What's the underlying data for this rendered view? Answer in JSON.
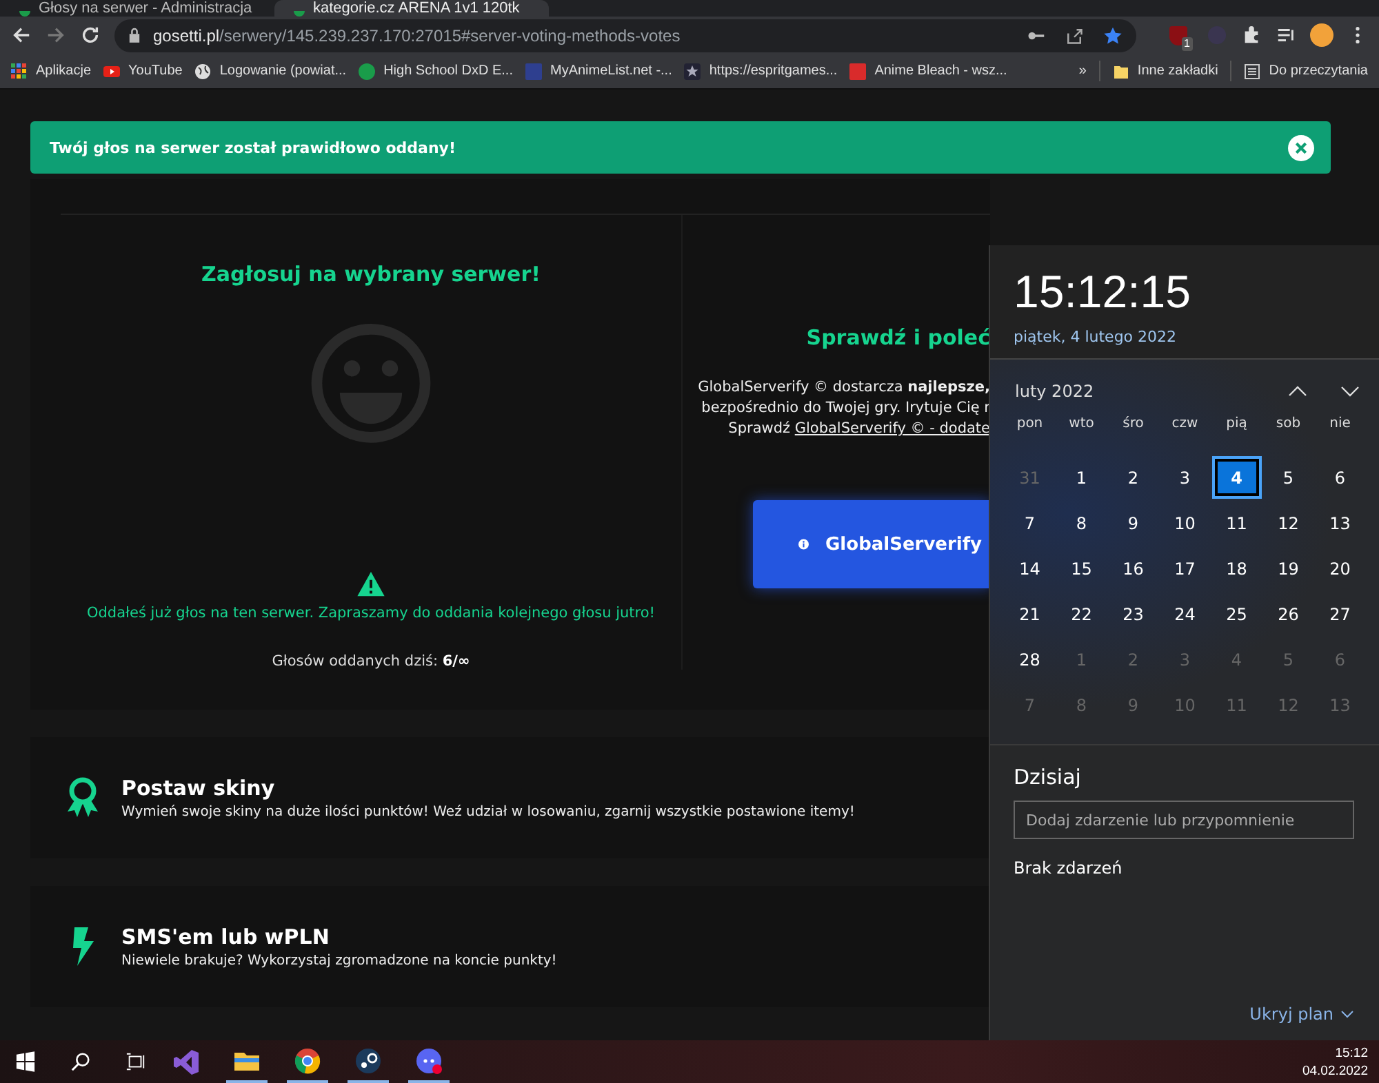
{
  "browser": {
    "tabs": [
      {
        "title": "Głosy na serwer - Administracja",
        "selected": false
      },
      {
        "title": "kategorie.cz ARENA 1v1 120tk",
        "selected": true
      }
    ],
    "url": {
      "host": "gosetti.pl",
      "path": "/serwery/145.239.237.170:27015#server-voting-methods-votes"
    },
    "extension_badge": "1",
    "bookmarks": [
      {
        "kind": "apps",
        "label": "Aplikacje"
      },
      {
        "kind": "youtube",
        "label": "YouTube"
      },
      {
        "kind": "globe",
        "label": "Logowanie (powiat..."
      },
      {
        "kind": "green",
        "label": "High School DxD E..."
      },
      {
        "kind": "navy",
        "label": "MyAnimeList.net -..."
      },
      {
        "kind": "star",
        "label": "https://espritgames..."
      },
      {
        "kind": "red",
        "label": "Anime Bleach - wsz..."
      }
    ],
    "overflow": "»",
    "other_bookmarks": "Inne zakładki",
    "reading_list": "Do przeczytania"
  },
  "alert": {
    "message": "Twój głos na serwer został prawidłowo oddany!",
    "dismissible": true
  },
  "vote": {
    "title": "Zagłosuj na wybrany serwer!",
    "notice": "Oddałeś już głos na ten serwer. Zapraszamy do oddania kolejnego głosu jutro!",
    "count_label": "Głosów oddanych dziś:",
    "count_value": "6/∞"
  },
  "promo": {
    "title": "Sprawdź i poleć",
    "lines": [
      "GlobalServerify © dostarcza **najlepsze,**",
      "bezpośrednio do Twojej gry. Irytuje Cię r"
    ],
    "link_prefix": "Sprawdź",
    "link": "GlobalServerify © - dodate",
    "button": "GlobalServerify"
  },
  "features": [
    {
      "kind": "award",
      "title": "Postaw skiny",
      "text": "Wymień swoje skiny na duże ilości punktów! Weź udział w losowaniu, zgarnij wszystkie postawione itemy!"
    },
    {
      "kind": "bolt",
      "title": "SMS'em lub wPLN",
      "text": "Niewiele brakuje? Wykorzystaj zgromadzone na koncie punkty!"
    }
  ],
  "calendar": {
    "time": "15:12:15",
    "date": "piątek, 4 lutego 2022",
    "month": "luty 2022",
    "weekdays": [
      "pon",
      "wto",
      "śro",
      "czw",
      "pią",
      "sob",
      "nie"
    ],
    "weeks": [
      [
        {
          "day": "31",
          "current": false,
          "selected": false
        },
        {
          "day": "1",
          "current": true,
          "selected": false
        },
        {
          "day": "2",
          "current": true,
          "selected": false
        },
        {
          "day": "3",
          "current": true,
          "selected": false
        },
        {
          "day": "4",
          "current": true,
          "selected": true
        },
        {
          "day": "5",
          "current": true,
          "selected": false
        },
        {
          "day": "6",
          "current": true,
          "selected": false
        }
      ],
      [
        {
          "day": "7",
          "current": true,
          "selected": false
        },
        {
          "day": "8",
          "current": true,
          "selected": false
        },
        {
          "day": "9",
          "current": true,
          "selected": false
        },
        {
          "day": "10",
          "current": true,
          "selected": false
        },
        {
          "day": "11",
          "current": true,
          "selected": false
        },
        {
          "day": "12",
          "current": true,
          "selected": false
        },
        {
          "day": "13",
          "current": true,
          "selected": false
        }
      ],
      [
        {
          "day": "14",
          "current": true,
          "selected": false
        },
        {
          "day": "15",
          "current": true,
          "selected": false
        },
        {
          "day": "16",
          "current": true,
          "selected": false
        },
        {
          "day": "17",
          "current": true,
          "selected": false
        },
        {
          "day": "18",
          "current": true,
          "selected": false
        },
        {
          "day": "19",
          "current": true,
          "selected": false
        },
        {
          "day": "20",
          "current": true,
          "selected": false
        }
      ],
      [
        {
          "day": "21",
          "current": true,
          "selected": false
        },
        {
          "day": "22",
          "current": true,
          "selected": false
        },
        {
          "day": "23",
          "current": true,
          "selected": false
        },
        {
          "day": "24",
          "current": true,
          "selected": false
        },
        {
          "day": "25",
          "current": true,
          "selected": false
        },
        {
          "day": "26",
          "current": true,
          "selected": false
        },
        {
          "day": "27",
          "current": true,
          "selected": false
        }
      ],
      [
        {
          "day": "28",
          "current": true,
          "selected": false
        },
        {
          "day": "1",
          "current": false,
          "selected": false
        },
        {
          "day": "2",
          "current": false,
          "selected": false
        },
        {
          "day": "3",
          "current": false,
          "selected": false
        },
        {
          "day": "4",
          "current": false,
          "selected": false
        },
        {
          "day": "5",
          "current": false,
          "selected": false
        },
        {
          "day": "6",
          "current": false,
          "selected": false
        }
      ],
      [
        {
          "day": "7",
          "current": false,
          "selected": false
        },
        {
          "day": "8",
          "current": false,
          "selected": false
        },
        {
          "day": "9",
          "current": false,
          "selected": false
        },
        {
          "day": "10",
          "current": false,
          "selected": false
        },
        {
          "day": "11",
          "current": false,
          "selected": false
        },
        {
          "day": "12",
          "current": false,
          "selected": false
        },
        {
          "day": "13",
          "current": false,
          "selected": false
        }
      ]
    ],
    "today_heading": "Dzisiaj",
    "event_placeholder": "Dodaj zdarzenie lub przypomnienie",
    "no_events": "Brak zdarzeń",
    "hide_plan": "Ukryj plan"
  },
  "taskbar": {
    "apps": [
      {
        "kind": "studio",
        "running": false
      },
      {
        "kind": "folder",
        "running": true
      },
      {
        "kind": "chrome",
        "running": true
      },
      {
        "kind": "steam",
        "running": true
      },
      {
        "kind": "discord",
        "running": true
      }
    ],
    "time": "15:12",
    "date": "04.02.2022"
  }
}
